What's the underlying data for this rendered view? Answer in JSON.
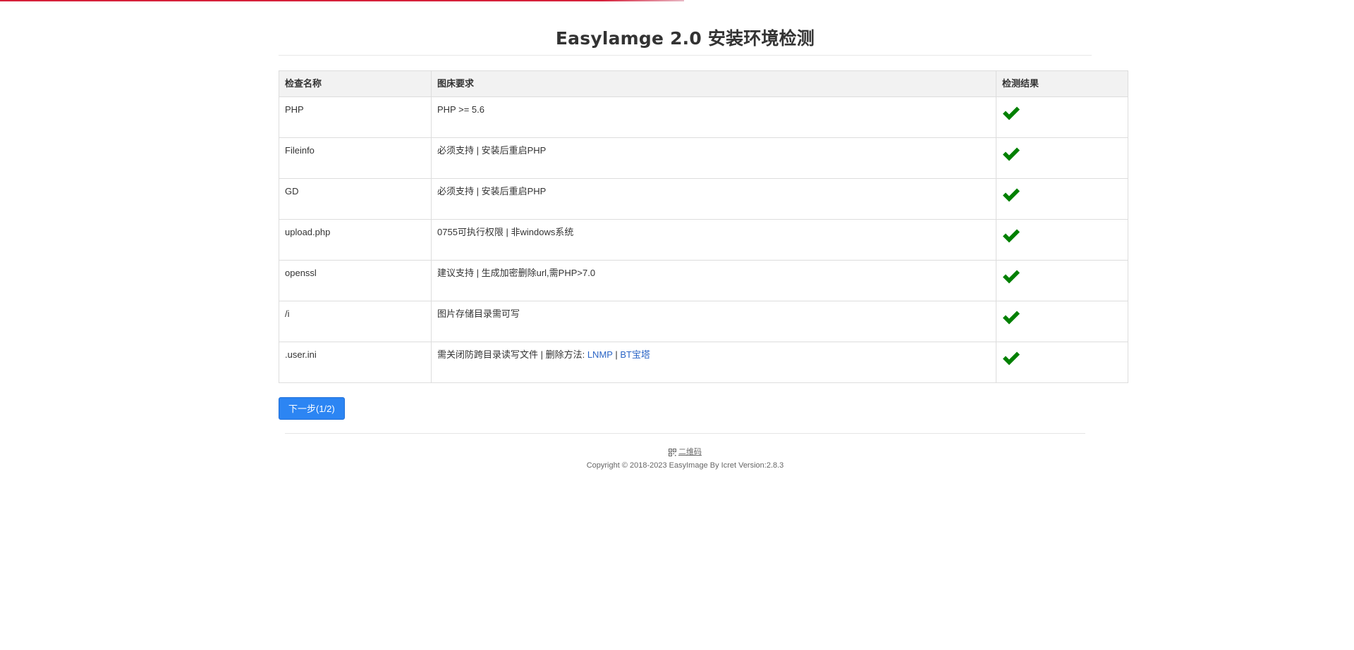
{
  "page": {
    "title": "Easylamge 2.0 安装环境检测"
  },
  "table": {
    "headers": {
      "name": "检查名称",
      "requirement": "图床要求",
      "result": "检测结果"
    },
    "rows": [
      {
        "name": "PHP",
        "requirement": "PHP >= 5.6",
        "result": "pass",
        "icon": "check-icon"
      },
      {
        "name": "Fileinfo",
        "requirement": "必须支持 | 安装后重启PHP",
        "result": "pass",
        "icon": "check-icon"
      },
      {
        "name": "GD",
        "requirement": "必须支持 | 安装后重启PHP",
        "result": "pass",
        "icon": "check-icon"
      },
      {
        "name": "upload.php",
        "requirement": "0755可执行权限 | 非windows系统",
        "result": "pass",
        "icon": "check-icon"
      },
      {
        "name": "openssl",
        "requirement": "建议支持 | 生成加密删除url,需PHP>7.0",
        "result": "pass",
        "icon": "check-icon"
      },
      {
        "name": "/i",
        "requirement": "图片存储目录需可写",
        "result": "pass",
        "icon": "check-icon"
      },
      {
        "name": ".user.ini",
        "requirement_prefix": "需关闭防跨目录读写文件 | 删除方法: ",
        "link_lnmp": "LNMP",
        "separator": " | ",
        "link_bt": "BT宝塔",
        "result": "pass",
        "icon": "check-icon"
      }
    ]
  },
  "actions": {
    "next_label": "下一步(1/2)"
  },
  "footer": {
    "qr_label": "二维码",
    "copyright": "Copyright © 2018-2023 EasyImage By Icret Version:2.8.3"
  },
  "colors": {
    "check": "#008000",
    "primary_button": "#2c85f3",
    "link": "#2a64c5",
    "progress": "#d6203a"
  }
}
